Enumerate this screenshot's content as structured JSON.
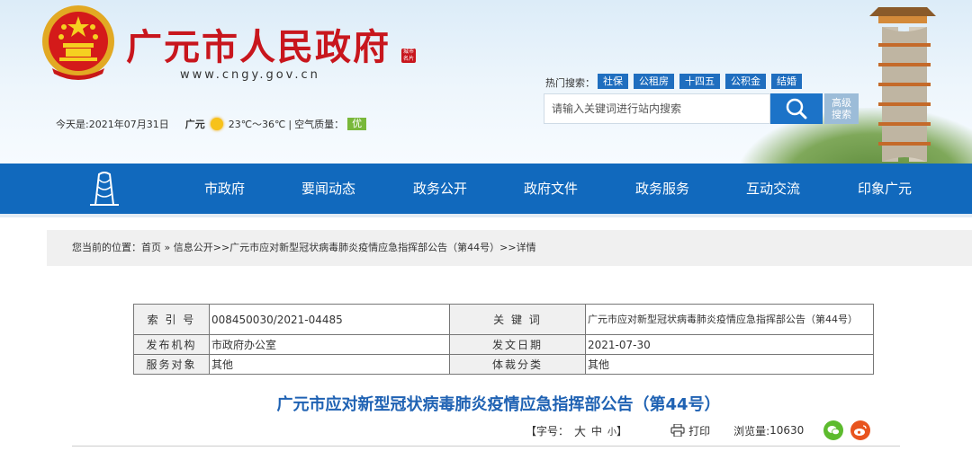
{
  "header": {
    "site_title": "广元市人民政府",
    "site_url": "www.cngy.gov.cn",
    "seal_text": "城市名片",
    "date_text": "今天是:2021年07月31日",
    "weather": {
      "city": "广元",
      "icon": "sun-icon",
      "temperature": "23℃～36℃",
      "separator": "|",
      "air_quality_label": "空气质量：",
      "air_quality_value": "优"
    },
    "hot_search": {
      "label": "热门搜索：",
      "tags": [
        "社保",
        "公租房",
        "十四五",
        "公积金",
        "结婚"
      ]
    },
    "search": {
      "placeholder": "请输入关键词进行站内搜索",
      "button_icon": "search-icon",
      "advanced_line1": "高级",
      "advanced_line2": "搜索"
    },
    "colors": {
      "title_red": "#c8161d",
      "nav_blue": "#1169bd",
      "tag_blue": "#1f6ebf"
    }
  },
  "nav": {
    "logo_icon": "city-logo-icon",
    "items": [
      "市政府",
      "要闻动态",
      "政务公开",
      "政府文件",
      "政务服务",
      "互动交流",
      "印象广元"
    ]
  },
  "breadcrumb": {
    "text": "您当前的位置：首页 » 信息公开>>广元市应对新型冠状病毒肺炎疫情应急指挥部公告（第44号）>>详情"
  },
  "info_table": {
    "rows": [
      {
        "label1": "索 引 号",
        "value1": "008450030/2021-04485",
        "label2": "关 键 词",
        "value2": "广元市应对新型冠状病毒肺炎疫情应急指挥部公告（第44号）"
      },
      {
        "label1": "发布机构",
        "value1": "市政府办公室",
        "label2": "发文日期",
        "value2": "2021-07-30"
      },
      {
        "label1": "服务对象",
        "value1": "其他",
        "label2": "体裁分类",
        "value2": "其他"
      }
    ]
  },
  "document": {
    "title": "广元市应对新型冠状病毒肺炎疫情应急指挥部公告（第44号）"
  },
  "tools": {
    "font_size_label": "【字号：",
    "font_large": "大",
    "font_medium": "中",
    "font_small": "小",
    "font_close": "】",
    "print_label": "打印",
    "views_label": "浏览量:",
    "views_count": "10630",
    "share": [
      {
        "icon": "wechat-icon",
        "color": "#5dbb2e"
      },
      {
        "icon": "weibo-icon",
        "color": "#e8541e"
      }
    ]
  }
}
